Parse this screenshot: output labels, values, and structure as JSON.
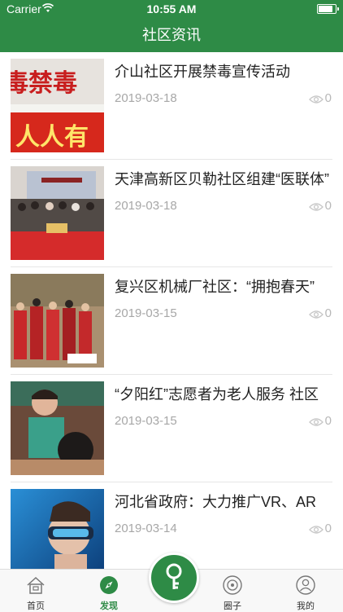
{
  "status_bar": {
    "carrier": "Carrier",
    "time": "10:55 AM"
  },
  "nav": {
    "title": "社区资讯"
  },
  "colors": {
    "brand": "#2e8b46",
    "text": "#222222",
    "muted": "#a7a7a7"
  },
  "articles": [
    {
      "title": "介山社区开展禁毒宣传活动",
      "date": "2019-03-18",
      "views": "0"
    },
    {
      "title": "天津高新区贝勒社区组建“医联体”",
      "date": "2019-03-18",
      "views": "0"
    },
    {
      "title": "复兴区机械厂社区：“拥抱春天”",
      "date": "2019-03-15",
      "views": "0"
    },
    {
      "title": "“夕阳红”志愿者为老人服务 社区",
      "date": "2019-03-15",
      "views": "0"
    },
    {
      "title": "河北省政府：大力推广VR、AR",
      "date": "2019-03-14",
      "views": "0"
    }
  ],
  "tabs": [
    {
      "label": "首页",
      "icon": "home-icon"
    },
    {
      "label": "发现",
      "icon": "compass-icon"
    },
    {
      "label": "",
      "icon": "key-icon"
    },
    {
      "label": "圈子",
      "icon": "circle-icon"
    },
    {
      "label": "我的",
      "icon": "person-icon"
    }
  ]
}
